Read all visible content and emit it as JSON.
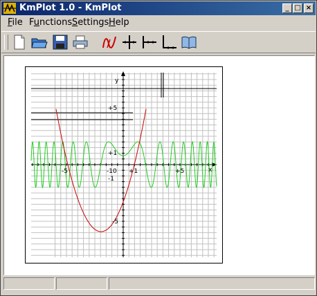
{
  "window": {
    "title": "KmPlot 1.0 - KmPlot",
    "buttons": [
      "_",
      "□",
      "×"
    ]
  },
  "menu": {
    "items": [
      {
        "label": "File",
        "accel": "F"
      },
      {
        "label": "Functions",
        "accel": "u"
      },
      {
        "label": "Settings",
        "accel": "S"
      },
      {
        "label": "Help",
        "accel": "H"
      }
    ]
  },
  "toolbar": {
    "items": [
      "new-file",
      "open-folder",
      "save-disk",
      "print",
      "function-editor",
      "axes-center",
      "axes-left",
      "axes-corner",
      "help-book"
    ]
  },
  "plot": {
    "tick_labels": {
      "y_axis": "y",
      "x_axis": "x",
      "plus5_y": "+5",
      "plus1_y": "+1",
      "minus1_y": "-1",
      "minus5_y": "-5",
      "minus5_x": "-5",
      "minus10_x": "-10",
      "plus1_x": "+1",
      "plus5_x": "+5"
    },
    "colors": {
      "parabola": "#cc0000",
      "wave": "#22cc22",
      "grid": "#c0c0c0",
      "axis": "#000000"
    }
  },
  "status": {
    "panels": [
      "",
      "",
      ""
    ]
  }
}
